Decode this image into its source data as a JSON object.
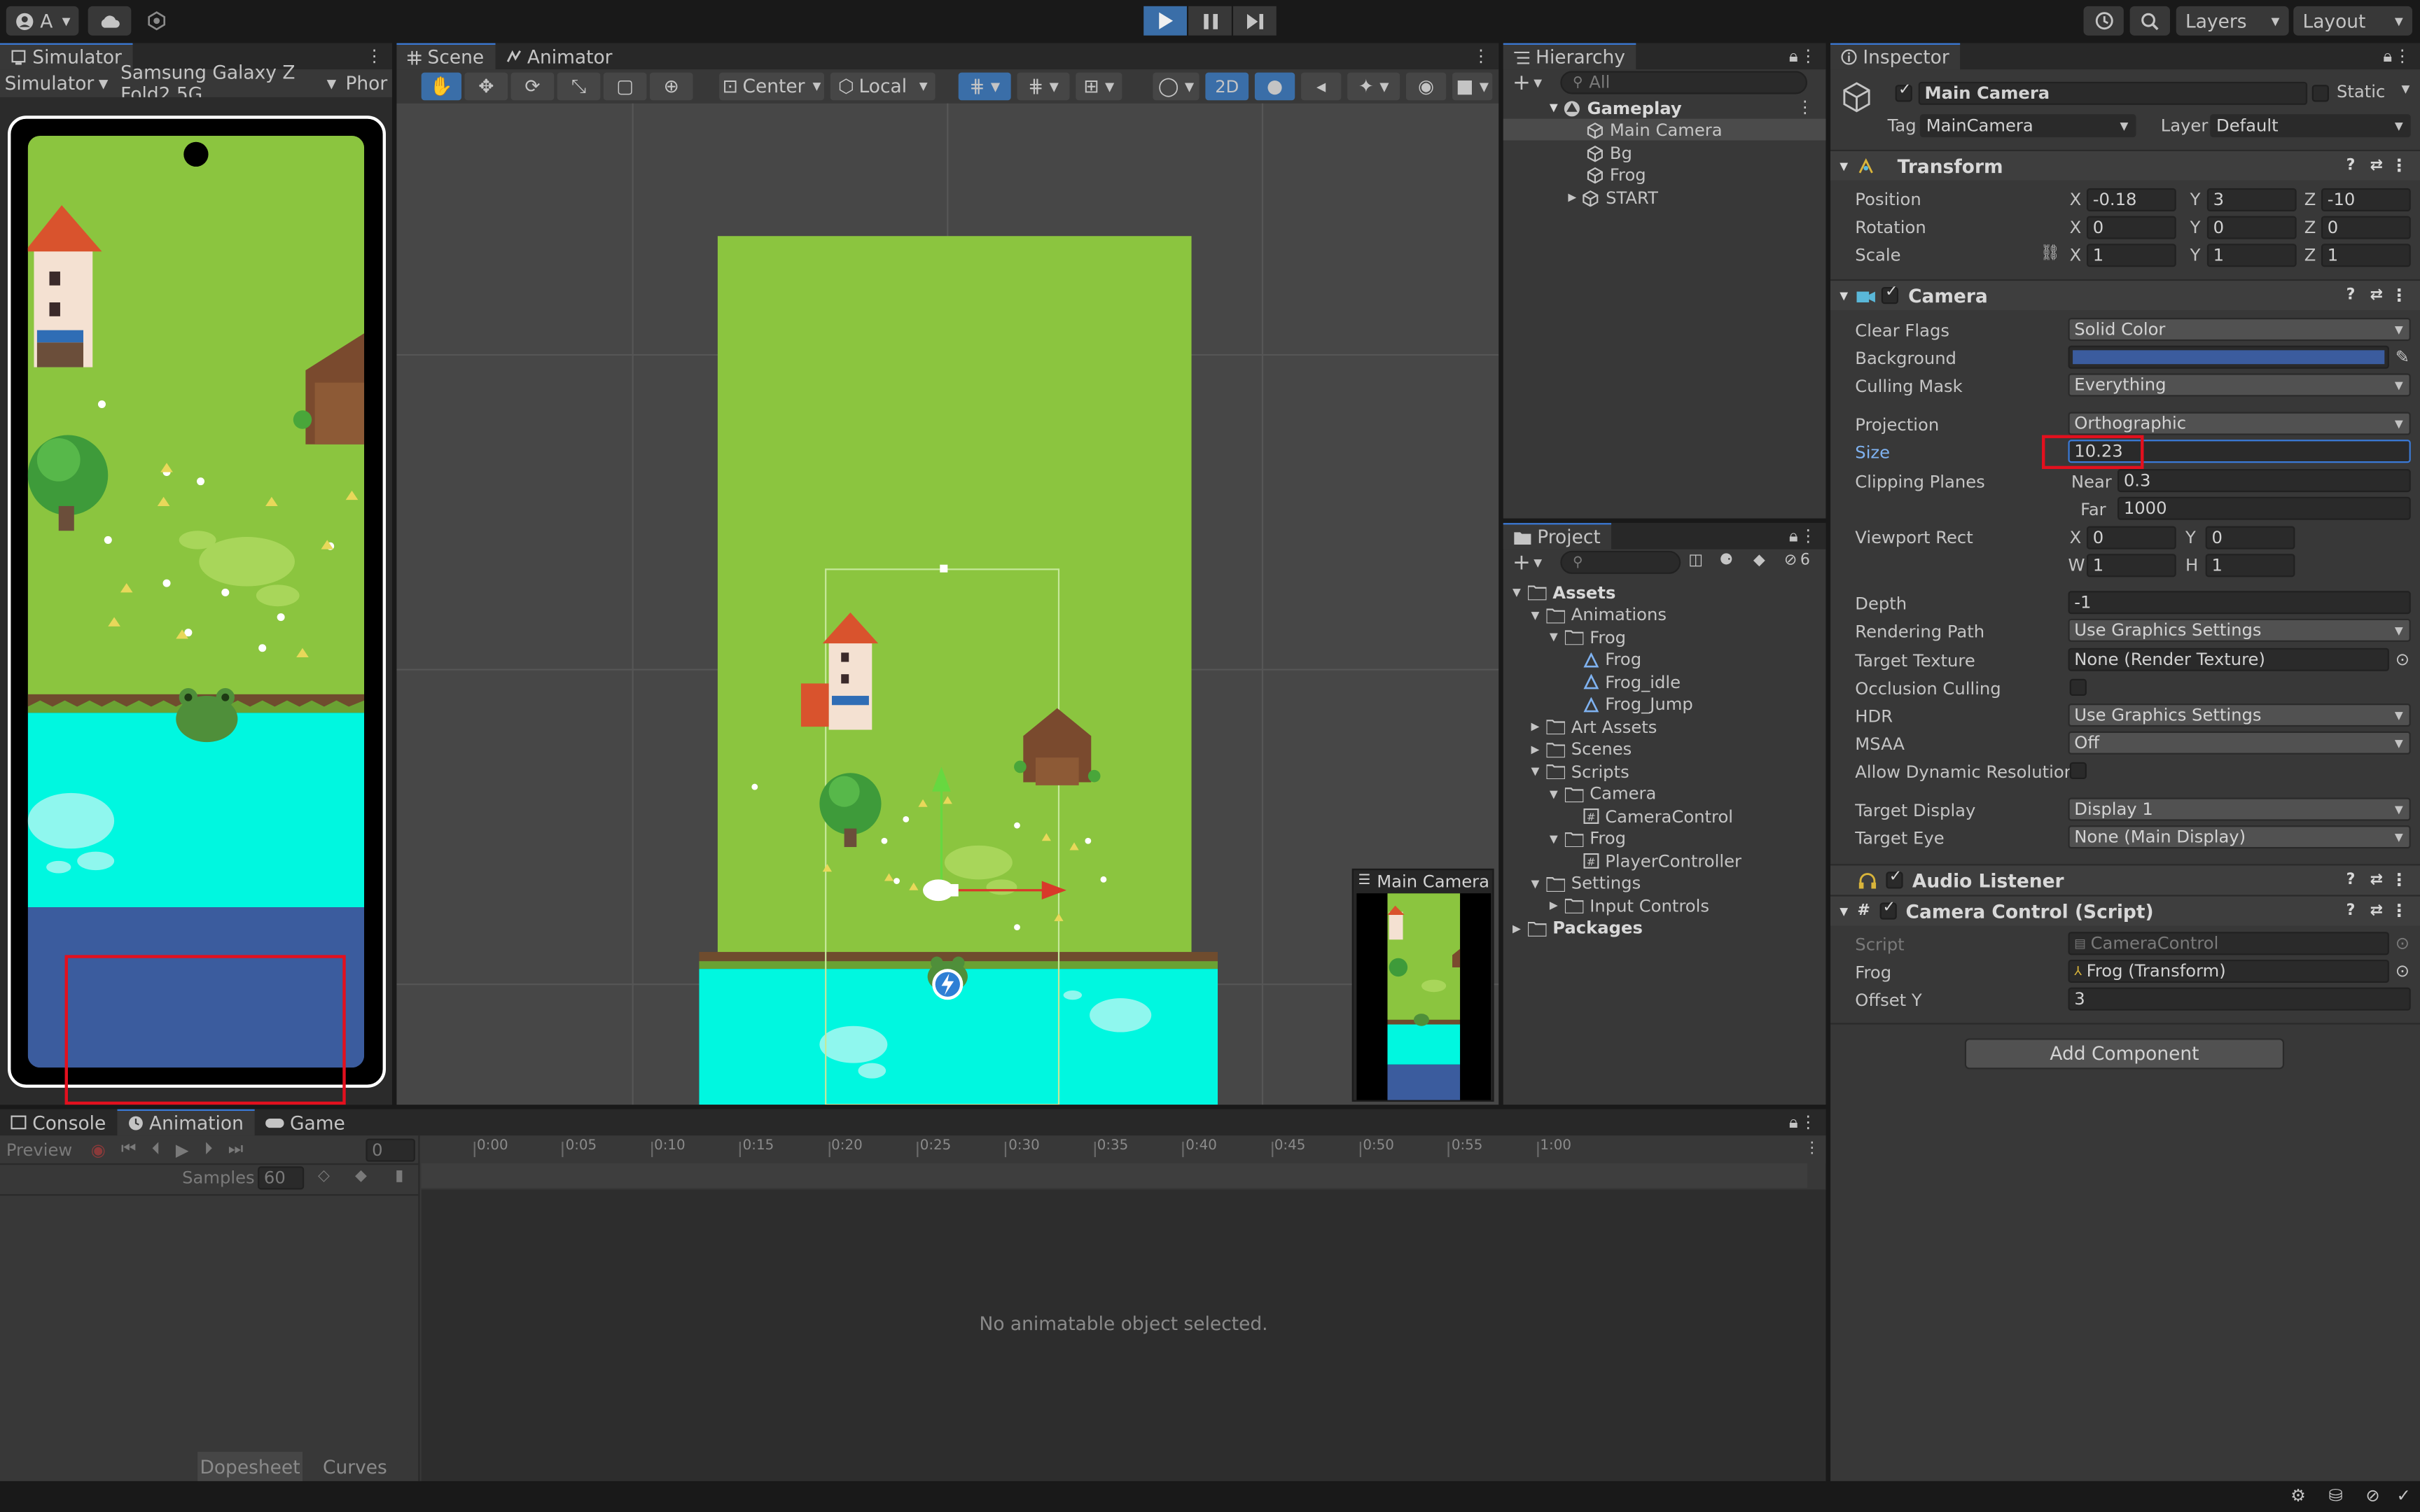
{
  "toolbar": {
    "account_label": "A",
    "layers_label": "Layers",
    "layout_label": "Layout"
  },
  "simulator": {
    "tab": "Simulator",
    "mode": "Simulator",
    "device": "Samsung Galaxy Z Fold2 5G",
    "orientation": "Phor"
  },
  "scene": {
    "tab_scene": "Scene",
    "tab_animator": "Animator",
    "pivot": "Center",
    "space": "Local",
    "mode_2d": "2D",
    "camera_preview_title": "Main Camera"
  },
  "hierarchy": {
    "tab": "Hierarchy",
    "search_placeholder": "All",
    "scene_name": "Gameplay",
    "items": [
      "Main Camera",
      "Bg",
      "Frog",
      "START"
    ]
  },
  "project": {
    "tab": "Project",
    "hidden_count": "6",
    "tree": [
      {
        "label": "Assets",
        "bold": true
      },
      {
        "label": "Animations"
      },
      {
        "label": "Frog"
      },
      {
        "label": "Frog"
      },
      {
        "label": "Frog_idle"
      },
      {
        "label": "Frog_Jump"
      },
      {
        "label": "Art Assets"
      },
      {
        "label": "Scenes"
      },
      {
        "label": "Scripts"
      },
      {
        "label": "Camera"
      },
      {
        "label": "CameraControl"
      },
      {
        "label": "Frog"
      },
      {
        "label": "PlayerController"
      },
      {
        "label": "Settings"
      },
      {
        "label": "Input Controls"
      },
      {
        "label": "Packages",
        "bold": true
      }
    ]
  },
  "inspector": {
    "tab": "Inspector",
    "object_name": "Main Camera",
    "static_label": "Static",
    "tag_label": "Tag",
    "tag_value": "MainCamera",
    "layer_label": "Layer",
    "layer_value": "Default",
    "transform": {
      "title": "Transform",
      "position_label": "Position",
      "rotation_label": "Rotation",
      "scale_label": "Scale",
      "position": {
        "x": "-0.18",
        "y": "3",
        "z": "-10"
      },
      "rotation": {
        "x": "0",
        "y": "0",
        "z": "0"
      },
      "scale": {
        "x": "1",
        "y": "1",
        "z": "1"
      }
    },
    "camera": {
      "title": "Camera",
      "clear_flags_label": "Clear Flags",
      "clear_flags": "Solid Color",
      "background_label": "Background",
      "background_color": "#3b5c9e",
      "culling_mask_label": "Culling Mask",
      "culling_mask": "Everything",
      "projection_label": "Projection",
      "projection": "Orthographic",
      "size_label": "Size",
      "size": "10.23",
      "clipping_planes_label": "Clipping Planes",
      "near_label": "Near",
      "near": "0.3",
      "far_label": "Far",
      "far": "1000",
      "viewport_rect_label": "Viewport Rect",
      "viewport": {
        "x": "0",
        "y": "0",
        "w": "1",
        "h": "1"
      },
      "depth_label": "Depth",
      "depth": "-1",
      "rendering_path_label": "Rendering Path",
      "rendering_path": "Use Graphics Settings",
      "target_texture_label": "Target Texture",
      "target_texture": "None (Render Texture)",
      "occlusion_culling_label": "Occlusion Culling",
      "hdr_label": "HDR",
      "hdr": "Use Graphics Settings",
      "msaa_label": "MSAA",
      "msaa": "Off",
      "allow_dynamic_resolution_label": "Allow Dynamic Resolution",
      "target_display_label": "Target Display",
      "target_display": "Display 1",
      "target_eye_label": "Target Eye",
      "target_eye": "None (Main Display)"
    },
    "audio_listener": {
      "title": "Audio Listener"
    },
    "camera_control": {
      "title": "Camera Control (Script)",
      "script_label": "Script",
      "script": "CameraControl",
      "frog_label": "Frog",
      "frog": "Frog (Transform)",
      "offset_y_label": "Offset Y",
      "offset_y": "3"
    },
    "add_component": "Add Component"
  },
  "bottom": {
    "tabs": [
      "Console",
      "Animation",
      "Game"
    ],
    "preview_label": "Preview",
    "frame": "0",
    "samples_label": "Samples",
    "samples": "60",
    "ticks": [
      "0:00",
      "0:05",
      "0:10",
      "0:15",
      "0:20",
      "0:25",
      "0:30",
      "0:35",
      "0:40",
      "0:45",
      "0:50",
      "0:55",
      "1:00"
    ],
    "empty_message": "No animatable object selected.",
    "dopesheet": "Dopesheet",
    "curves": "Curves"
  },
  "colors": {
    "grass": "#8bc53f",
    "water": "#00f7e0",
    "deep": "#3b5c9e",
    "highlight": "#e3101e",
    "accent": "#3a7ad8"
  }
}
